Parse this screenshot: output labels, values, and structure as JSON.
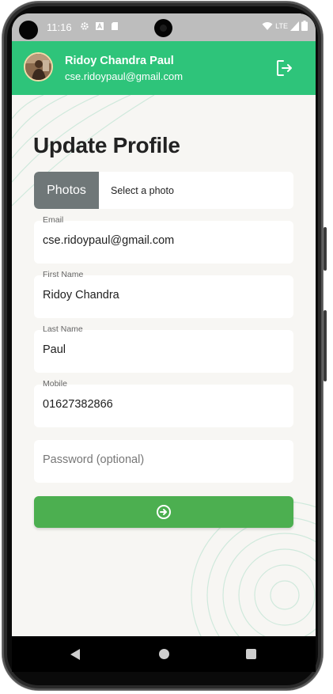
{
  "status_bar": {
    "time": "11:16",
    "network": "LTE",
    "icons": [
      "gear-icon",
      "font-a-icon",
      "sd-card-icon",
      "wifi-icon",
      "signal-icon",
      "battery-icon"
    ]
  },
  "header": {
    "user_name": "Ridoy Chandra Paul",
    "user_email": "cse.ridoypaul@gmail.com",
    "logout_icon": "logout-icon",
    "background_color": "#2ec47a"
  },
  "form": {
    "title": "Update Profile",
    "photos_button": "Photos",
    "photo_hint": "Select a photo",
    "fields": [
      {
        "label": "Email",
        "value": "cse.ridoypaul@gmail.com"
      },
      {
        "label": "First Name",
        "value": "Ridoy Chandra"
      },
      {
        "label": "Last Name",
        "value": "Paul"
      },
      {
        "label": "Mobile",
        "value": "01627382866"
      }
    ],
    "password_placeholder": "Password (optional)",
    "submit_icon": "arrow-right-circle-icon",
    "submit_color": "#4caf50"
  },
  "nav_bar": {
    "icons": [
      "back-icon",
      "home-icon",
      "recents-icon"
    ]
  }
}
